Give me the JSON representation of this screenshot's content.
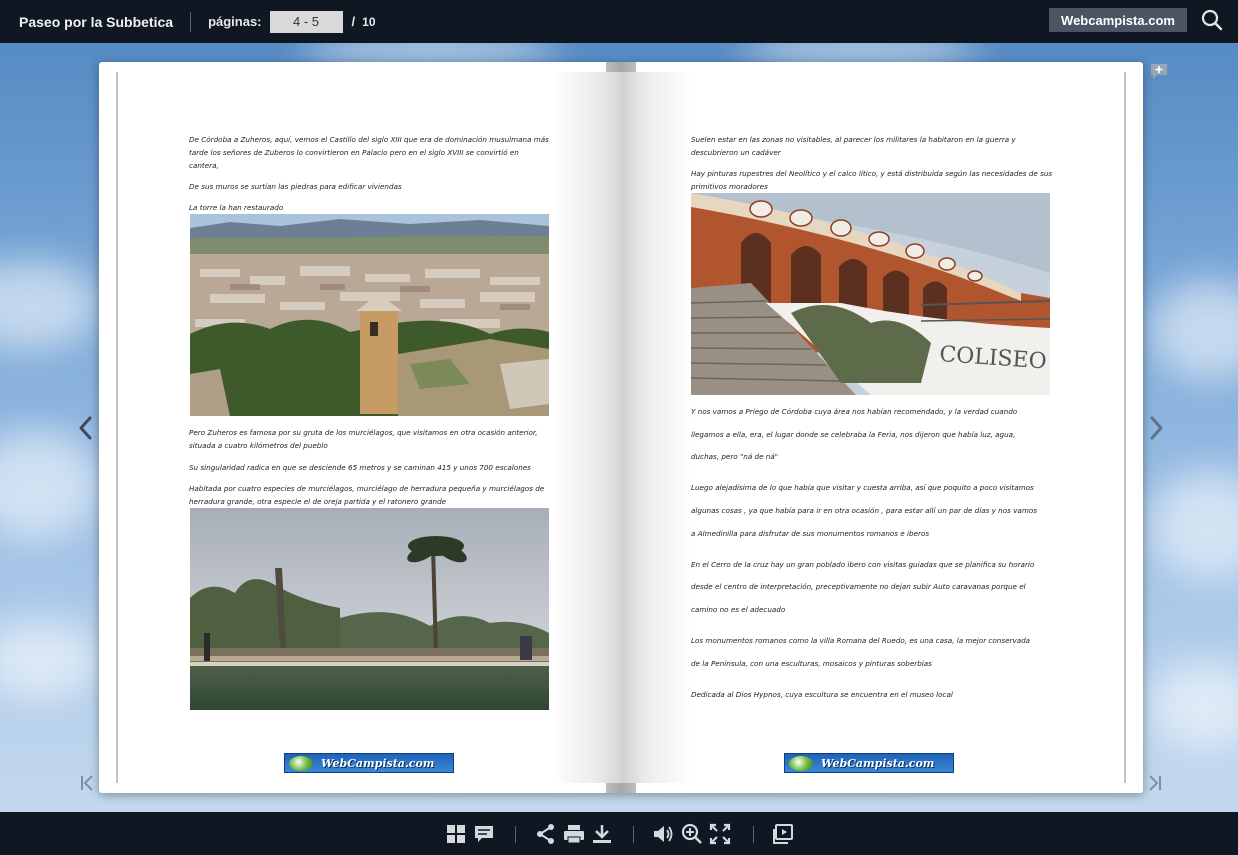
{
  "header": {
    "title": "Paseo por la Subbetica",
    "pages_label": "páginas:",
    "current_pages": "4 - 5",
    "separator": "/",
    "total_pages": "10",
    "brand_button": "Webcampista.com"
  },
  "left_page": {
    "paragraphs": [
      "De Córdoba a Zuheros, aquí, vemos el Castillo del siglo XIII que era de dominación musulmana más tarde los señores de Zuberos lo convirtieron en Palacio pero en el siglo XVIII se convirtió en cantera,",
      " De sus muros se surtían las piedras para edificar viviendas",
      "La torre la han restaurado",
      "Pero Zuheros es famosa por su gruta de los murciélagos, que visitamos en otra ocasión anterior, situada a cuatro kilómetros del pueblo",
      "Su singularidad  radica en que se desciende 65 metros y se caminan 415 y unos 700 escalones",
      "Habitada por cuatro especies de murciélagos, murciélago de herradura pequeña y murciélagos de herradura grande, otra especie el de oreja partida y el ratonero grande"
    ],
    "logo_text": "WebCampista.com"
  },
  "right_page": {
    "paragraphs": [
      "Suelen estar en las zonas no visitables, al parecer los militares la habitaron en la guerra y descubrieron un cadáver",
      "Hay pinturas rupestres del Neolítico y el calco lítico, y está distribuida según las necesidades de sus primitivos moradores",
      "Y nos vamos a Priego de Córdoba cuya área nos habían recomendado, y la verdad cuando",
      "llegamos a ella, era, el lugar donde se celebraba la Feria, nos dijeron que había luz, agua,",
      "duchas, pero \"ná de ná\"",
      "Luego alejadísima de lo que había que visitar y cuesta arriba, así que  poquito a poco  visitamos",
      "algunas cosas , ya que había  para ir en otra ocasión , para estar allí un par de días y nos vamos",
      "a  Almedinilla para disfrutar de sus monumentos romanos e iberos",
      "En el Cerro de la cruz hay un gran poblado ibero con visitas guiadas que se planifica su horario",
      "desde el centro de interpretación, preceptivamente no dejan subir Auto caravanas porque el",
      "camino no es el adecuado",
      "Los monumentos romanos como  la villa Romana del Ruedo, es una casa, la mejor conservada",
      "de la Península, con una esculturas, mosaicos y pinturas soberbias",
      "Dedicada al Dios Hypnos, cuya escultura se encuentra en el museo local"
    ],
    "sign_text": "COLISEO",
    "logo_text": "WebCampista.com"
  },
  "toolbar": {
    "icons": [
      "thumbnails-icon",
      "comment-icon",
      "share-icon",
      "print-icon",
      "download-icon",
      "volume-icon",
      "zoom-in-icon",
      "fullscreen-icon",
      "slideshow-icon"
    ]
  },
  "colors": {
    "bar_background": "#0f1723",
    "brand_button": "#4b5563",
    "page_input": "#d9d9d9"
  }
}
